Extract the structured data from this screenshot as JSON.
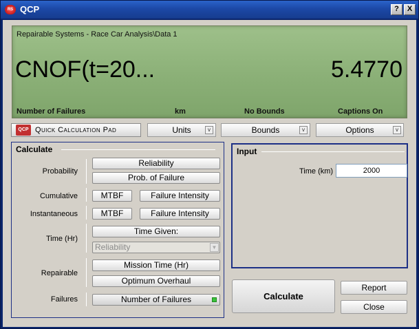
{
  "window": {
    "title": "QCP",
    "app_icon": "RS",
    "help_button": "?",
    "close_button": "X"
  },
  "display": {
    "path": "Repairable Systems - Race Car Analysis\\Data 1",
    "function": "CNOF(t=20...",
    "value": "5.4770",
    "status": {
      "measure": "Number of Failures",
      "units": "km",
      "bounds": "No Bounds",
      "captions": "Captions On"
    }
  },
  "toolbar": {
    "qcp_icon": "QCP",
    "qcp_label": "Quick Calculation Pad",
    "units": "Units",
    "bounds": "Bounds",
    "options": "Options",
    "chevron": "v"
  },
  "calculate": {
    "title": "Calculate",
    "rows": {
      "probability": {
        "label": "Probability",
        "reliability": "Reliability",
        "prob_failure": "Prob. of Failure"
      },
      "cumulative": {
        "label": "Cumulative",
        "mtbf": "MTBF",
        "failure_intensity": "Failure Intensity"
      },
      "instantaneous": {
        "label": "Instantaneous",
        "mtbf": "MTBF",
        "failure_intensity": "Failure Intensity"
      },
      "time": {
        "label": "Time (Hr)",
        "time_given": "Time Given:",
        "combo_value": "Reliability"
      },
      "repairable": {
        "label": "Repairable",
        "mission_time": "Mission Time (Hr)",
        "optimum_overhaul": "Optimum Overhaul"
      },
      "failures": {
        "label": "Failures",
        "number_of_failures": "Number of Failures"
      }
    }
  },
  "input": {
    "title": "Input",
    "time_label": "Time (km)",
    "time_value": "2000"
  },
  "actions": {
    "calculate": "Calculate",
    "report": "Report",
    "close": "Close"
  }
}
